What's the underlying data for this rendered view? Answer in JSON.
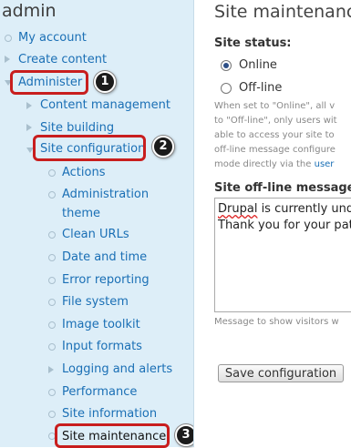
{
  "sidebar": {
    "user": "admin",
    "items": [
      {
        "label": "My account"
      },
      {
        "label": "Create content"
      },
      {
        "label": "Administer"
      },
      {
        "label": "Content management"
      },
      {
        "label": "Site building"
      },
      {
        "label": "Site configuration"
      },
      {
        "label": "Actions"
      },
      {
        "label": "Administration"
      },
      {
        "label": "theme"
      },
      {
        "label": "Clean URLs"
      },
      {
        "label": "Date and time"
      },
      {
        "label": "Error reporting"
      },
      {
        "label": "File system"
      },
      {
        "label": "Image toolkit"
      },
      {
        "label": "Input formats"
      },
      {
        "label": "Logging and alerts"
      },
      {
        "label": "Performance"
      },
      {
        "label": "Site information"
      },
      {
        "label": "Site maintenance"
      }
    ]
  },
  "callouts": [
    "1",
    "2",
    "3"
  ],
  "highlight_color": "#c81e1e",
  "main": {
    "title": "Site maintenance",
    "status_label": "Site status:",
    "options": [
      {
        "label": "Online",
        "selected": true
      },
      {
        "label": "Off-line",
        "selected": false
      }
    ],
    "description_lines": [
      "When set to \"Online\", all v",
      "to \"Off-line\", only users wit",
      "able to access your site to",
      "off-line message configure",
      "mode directly via the "
    ],
    "description_link": "user",
    "message_label": "Site off-line message:",
    "message_lines": [
      "Drupal",
      " is currently unde",
      "Thank you for your pat"
    ],
    "help": "Message to show visitors w",
    "save_button": "Save configuration"
  }
}
